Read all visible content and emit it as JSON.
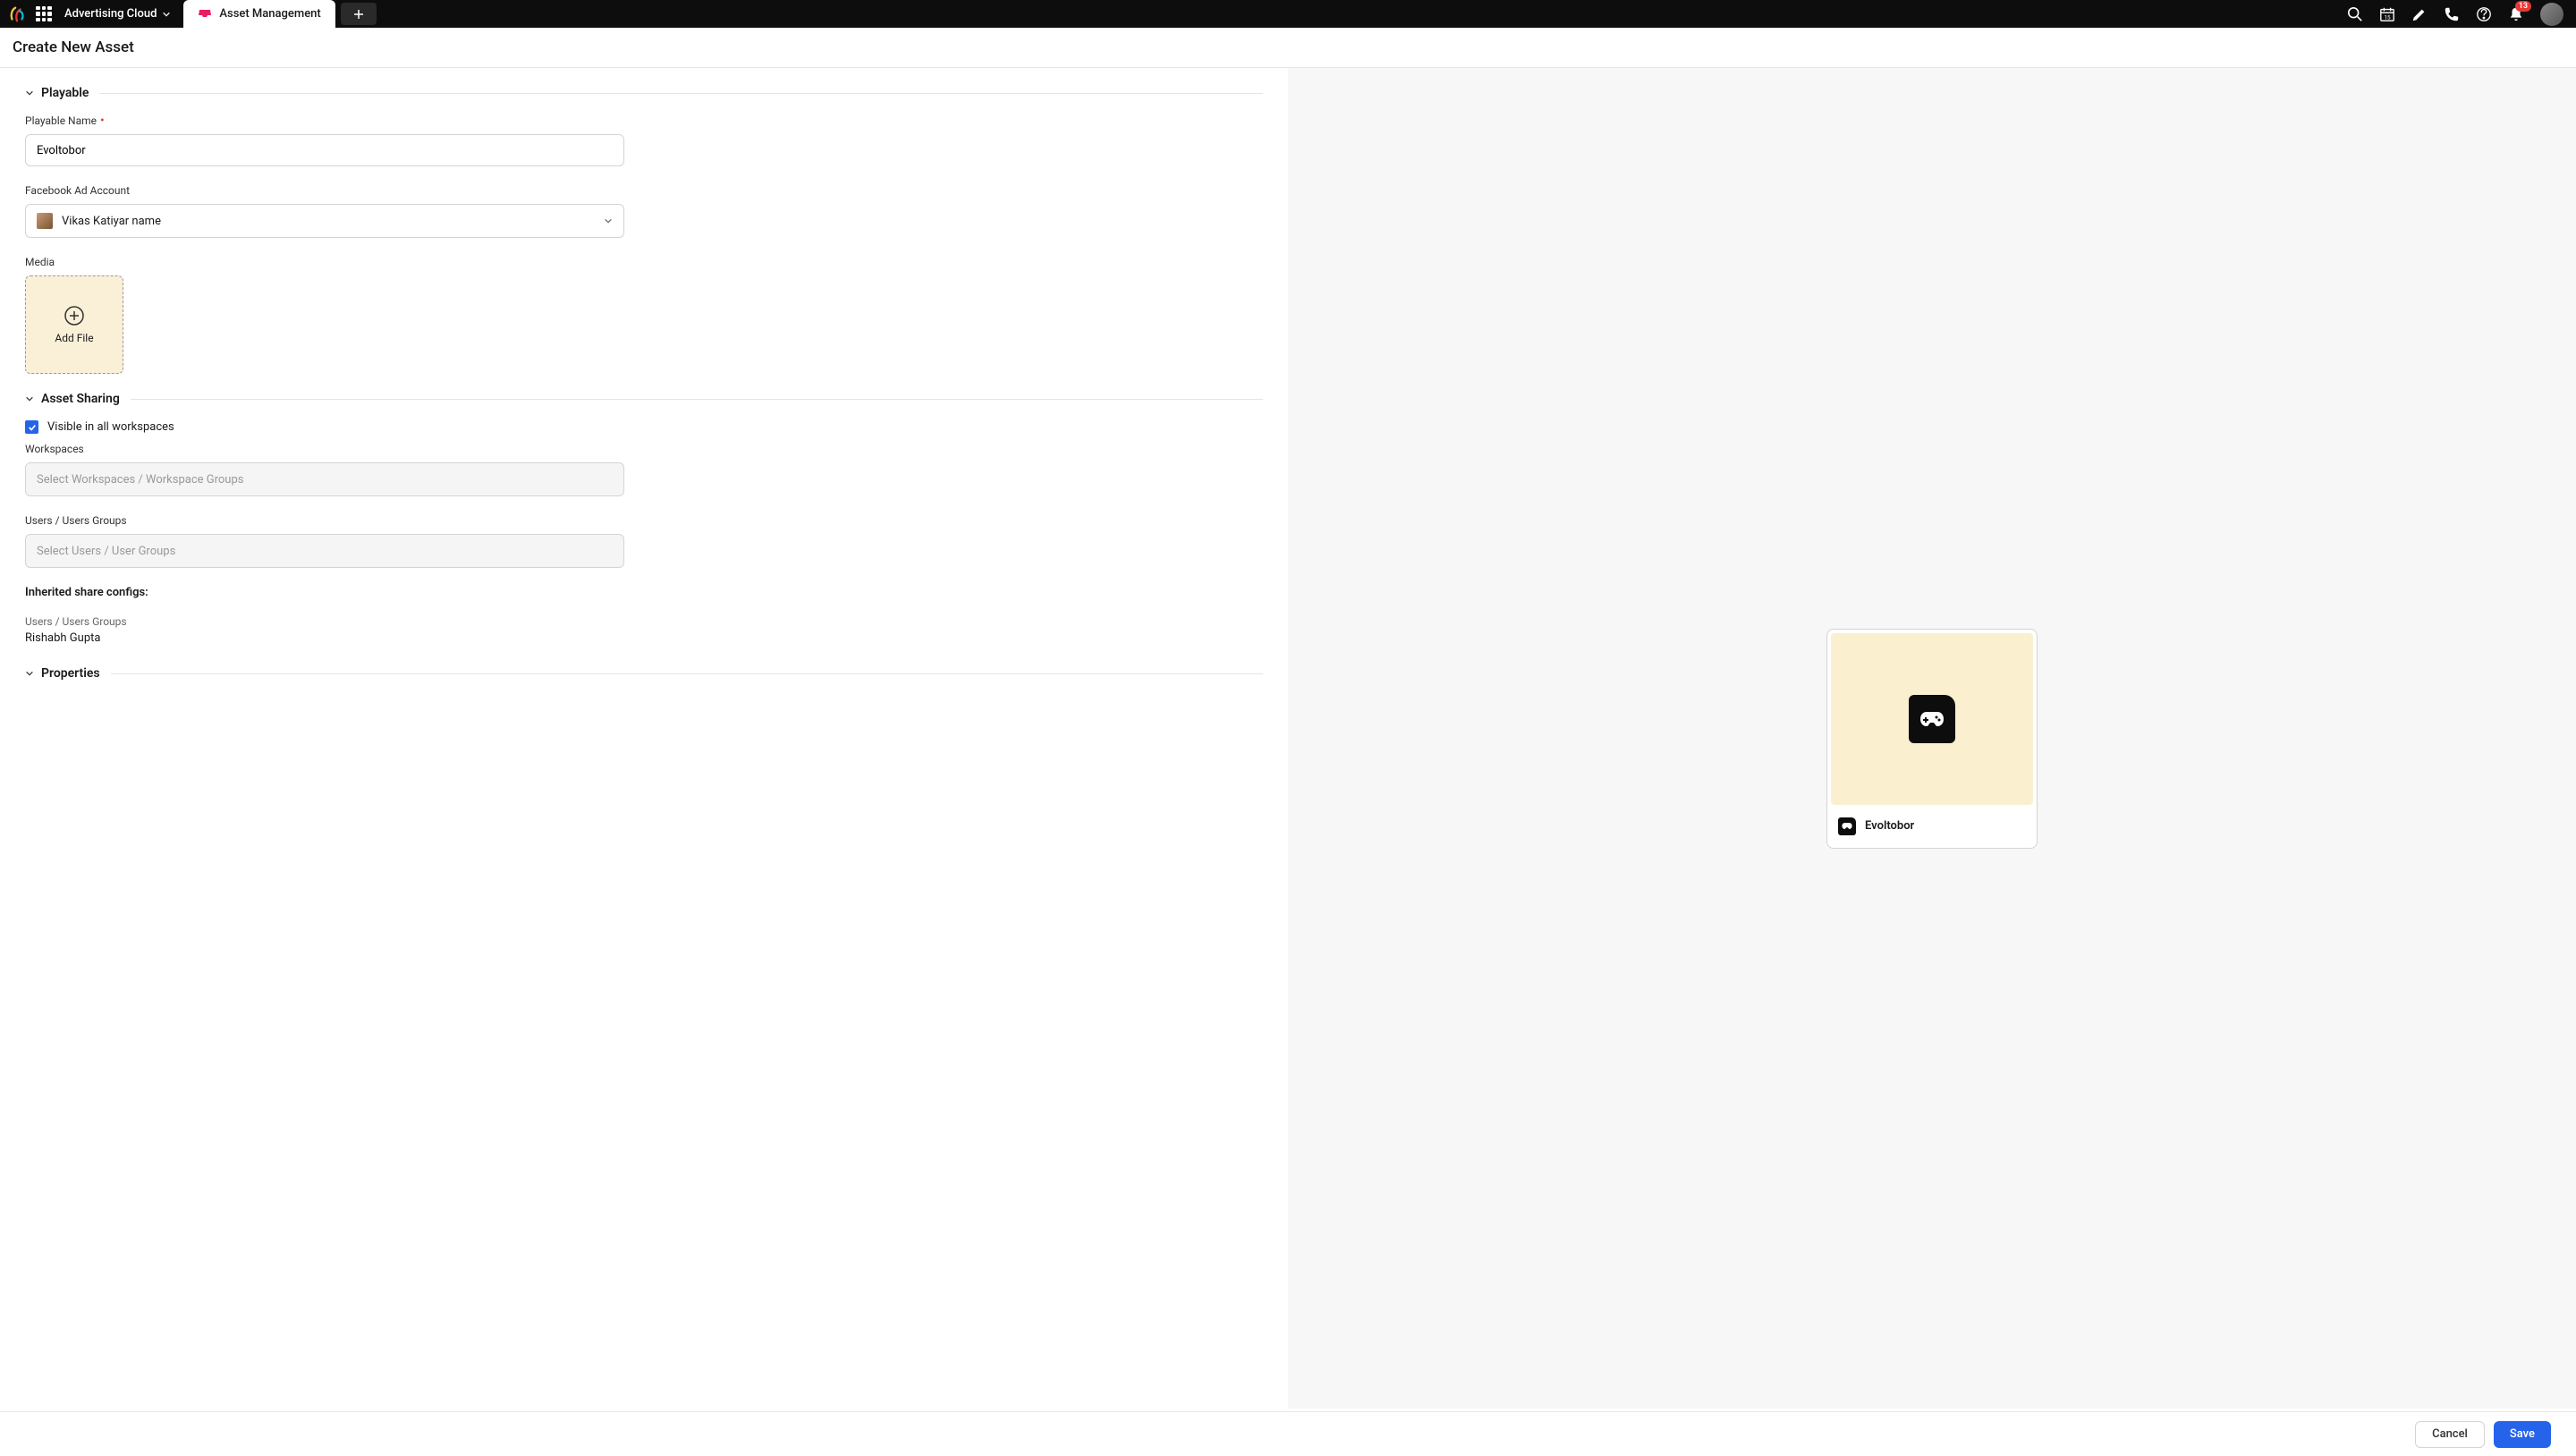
{
  "topbar": {
    "workspace": "Advertising Cloud",
    "tab_label": "Asset Management",
    "notification_count": "13"
  },
  "page": {
    "title": "Create New Asset"
  },
  "sections": {
    "playable": {
      "title": "Playable",
      "name_label": "Playable Name",
      "name_value": "Evoltobor",
      "ad_account_label": "Facebook Ad Account",
      "ad_account_value": "Vikas Katiyar name",
      "media_label": "Media",
      "add_file_label": "Add File"
    },
    "sharing": {
      "title": "Asset Sharing",
      "visible_label": "Visible in all workspaces",
      "workspaces_label": "Workspaces",
      "workspaces_placeholder": "Select Workspaces / Workspace Groups",
      "users_label": "Users / Users Groups",
      "users_placeholder": "Select Users / User Groups",
      "inherited_title": "Inherited share configs:",
      "inherited_users_label": "Users / Users Groups",
      "inherited_users_value": "Rishabh Gupta"
    },
    "properties": {
      "title": "Properties"
    }
  },
  "preview": {
    "name": "Evoltobor"
  },
  "footer": {
    "cancel": "Cancel",
    "save": "Save"
  }
}
